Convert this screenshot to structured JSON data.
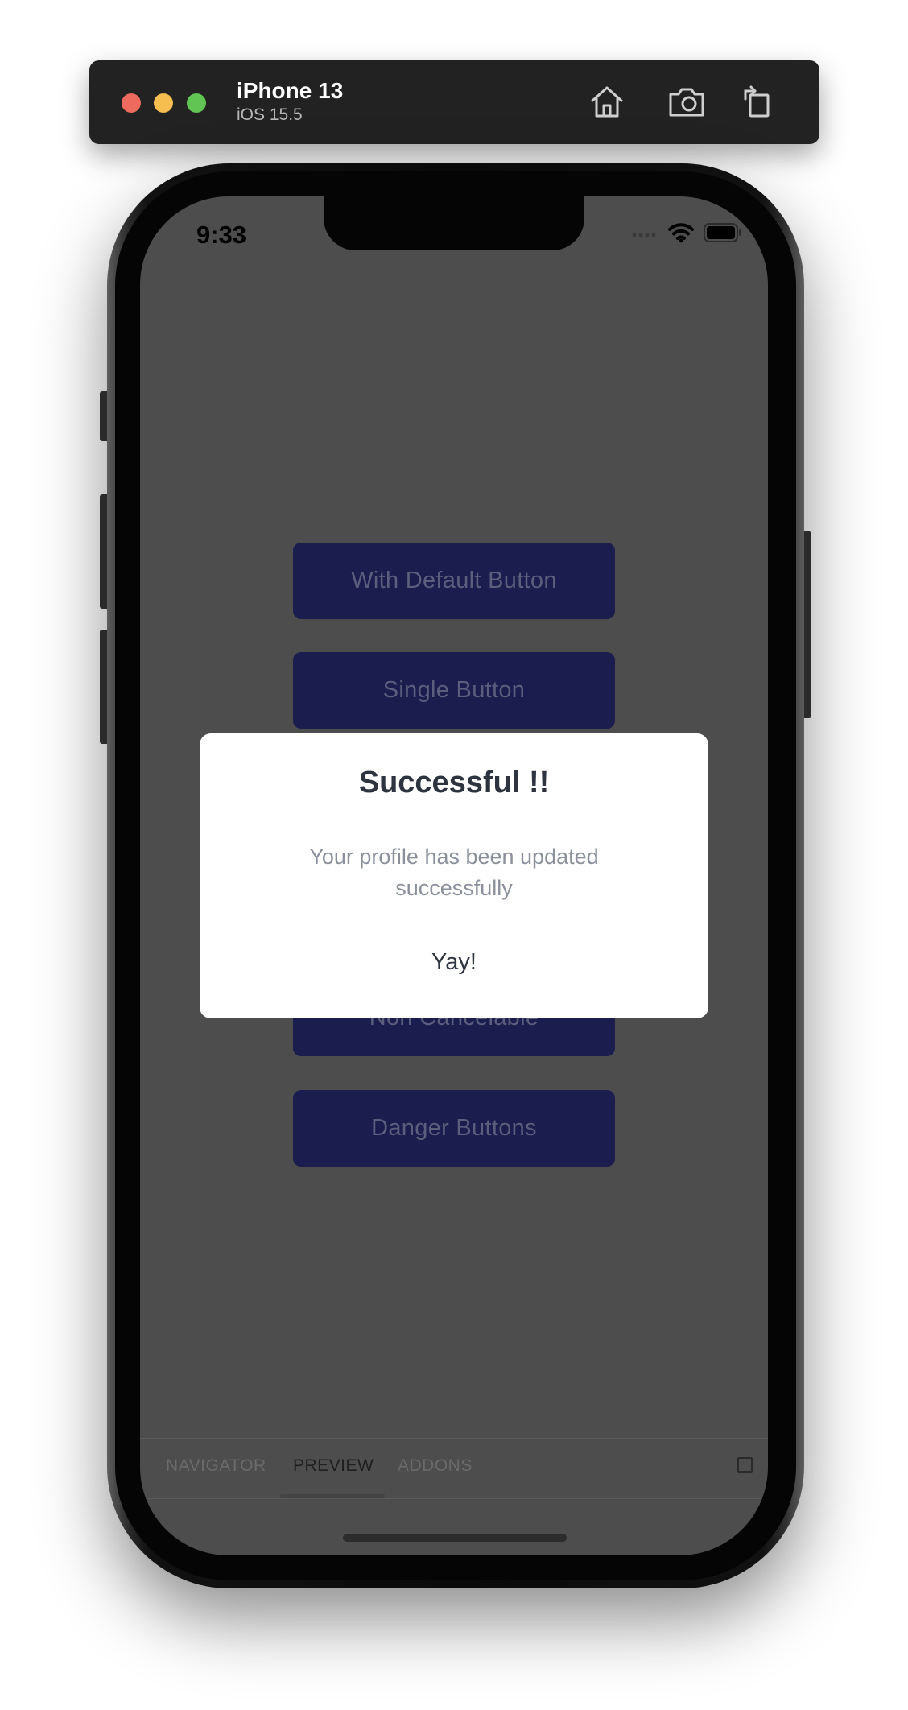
{
  "simulator": {
    "device_name": "iPhone 13",
    "os_version": "iOS 15.5",
    "toolbar_icons": [
      "home-icon",
      "screenshot-icon",
      "rotate-icon"
    ]
  },
  "status_bar": {
    "time": "9:33"
  },
  "app_buttons": [
    {
      "label": "With Default Button"
    },
    {
      "label": "Single Button"
    },
    {
      "label": "Non Cancelable"
    },
    {
      "label": "Danger Buttons"
    }
  ],
  "modal": {
    "title": "Successful !!",
    "message": "Your profile has been updated successfully",
    "action_label": "Yay!"
  },
  "storybook_tabs": [
    {
      "label": "NAVIGATOR",
      "active": false
    },
    {
      "label": "PREVIEW",
      "active": true
    },
    {
      "label": "ADDONS",
      "active": false
    }
  ],
  "colors": {
    "button_bg": "#1a1d4e",
    "overlay_bg": "#4d4d4d",
    "modal_bg": "#ffffff",
    "title_text": "#2d3440",
    "message_text": "#8a909c"
  }
}
